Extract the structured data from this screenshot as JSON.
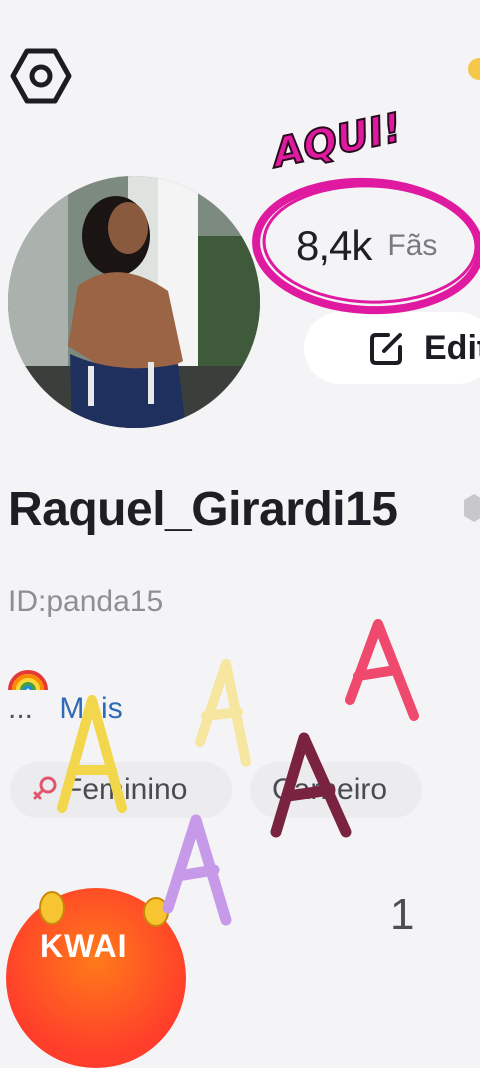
{
  "profile": {
    "fans_count": "8,4k",
    "fans_label": "Fãs",
    "edit_label": "Edit",
    "username": "Raquel_Girardi15",
    "user_id": "ID:panda15",
    "bio_ellipsis": "...",
    "bio_more": "Mais",
    "tags": {
      "gender": "Feminino",
      "sign": "Carneiro"
    },
    "stat_count": "1"
  },
  "overlay": {
    "annotation": "AQUI!",
    "promo_badge": "KWAI"
  },
  "colors": {
    "highlight_circle": "#e01aa0",
    "link_blue": "#2e6bb5",
    "background": "#f4f4f6"
  },
  "icons": {
    "settings": "hexagon-gear-icon",
    "edit": "edit-square-icon",
    "gender": "female-symbol-icon",
    "emoji": "rainbow-emoji"
  }
}
